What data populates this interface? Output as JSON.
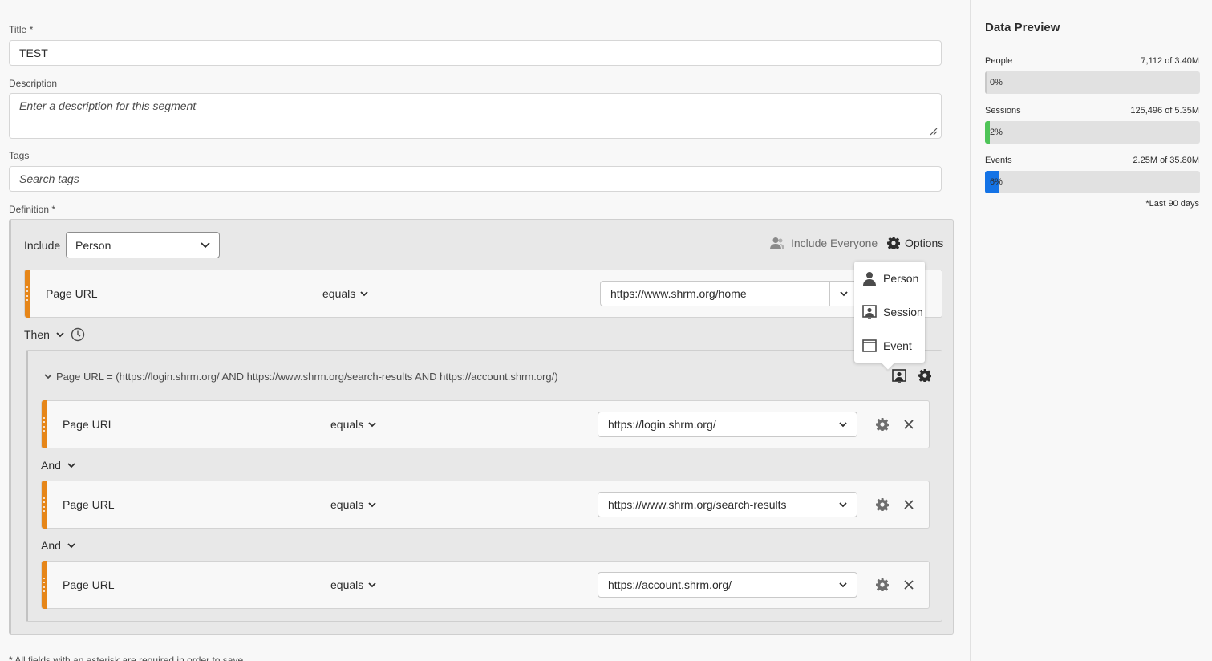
{
  "form": {
    "title_label": "Title",
    "title_value": "TEST",
    "description_label": "Description",
    "description_placeholder": "Enter a description for this segment",
    "tags_label": "Tags",
    "tags_placeholder": "Search tags",
    "definition_label": "Definition",
    "required_mark": "*",
    "footer_note": "* All fields with an asterisk are required in order to save."
  },
  "definition": {
    "include_label": "Include",
    "include_value": "Person",
    "include_everyone": "Include Everyone",
    "options": "Options",
    "first_rule": {
      "dimension": "Page URL",
      "operator": "equals",
      "value": "https://www.shrm.org/home"
    },
    "then_label": "Then",
    "container_title": "Page URL = (https://login.shrm.org/ AND https://www.shrm.org/search-results AND https://account.shrm.org/)",
    "container_rules": [
      {
        "dimension": "Page URL",
        "operator": "equals",
        "value": "https://login.shrm.org/"
      },
      {
        "dimension": "Page URL",
        "operator": "equals",
        "value": "https://www.shrm.org/search-results"
      },
      {
        "dimension": "Page URL",
        "operator": "equals",
        "value": "https://account.shrm.org/"
      }
    ],
    "and_label": "And"
  },
  "context_menu": {
    "items": [
      "Person",
      "Session",
      "Event"
    ]
  },
  "preview": {
    "title": "Data Preview",
    "metrics": [
      {
        "label": "People",
        "value": "7,112 of 3.40M",
        "pct": "0%",
        "fraction": 0.002,
        "color": "#c8c8c8"
      },
      {
        "label": "Sessions",
        "value": "125,496 of 5.35M",
        "pct": "2%",
        "fraction": 0.023,
        "color": "#4fc458"
      },
      {
        "label": "Events",
        "value": "2.25M of 35.80M",
        "pct": "6%",
        "fraction": 0.063,
        "color": "#1473e6"
      }
    ],
    "note": "*Last 90 days"
  },
  "colors": {
    "accent_orange": "#e68619",
    "sessions_green": "#4fc458",
    "events_blue": "#1473e6"
  }
}
